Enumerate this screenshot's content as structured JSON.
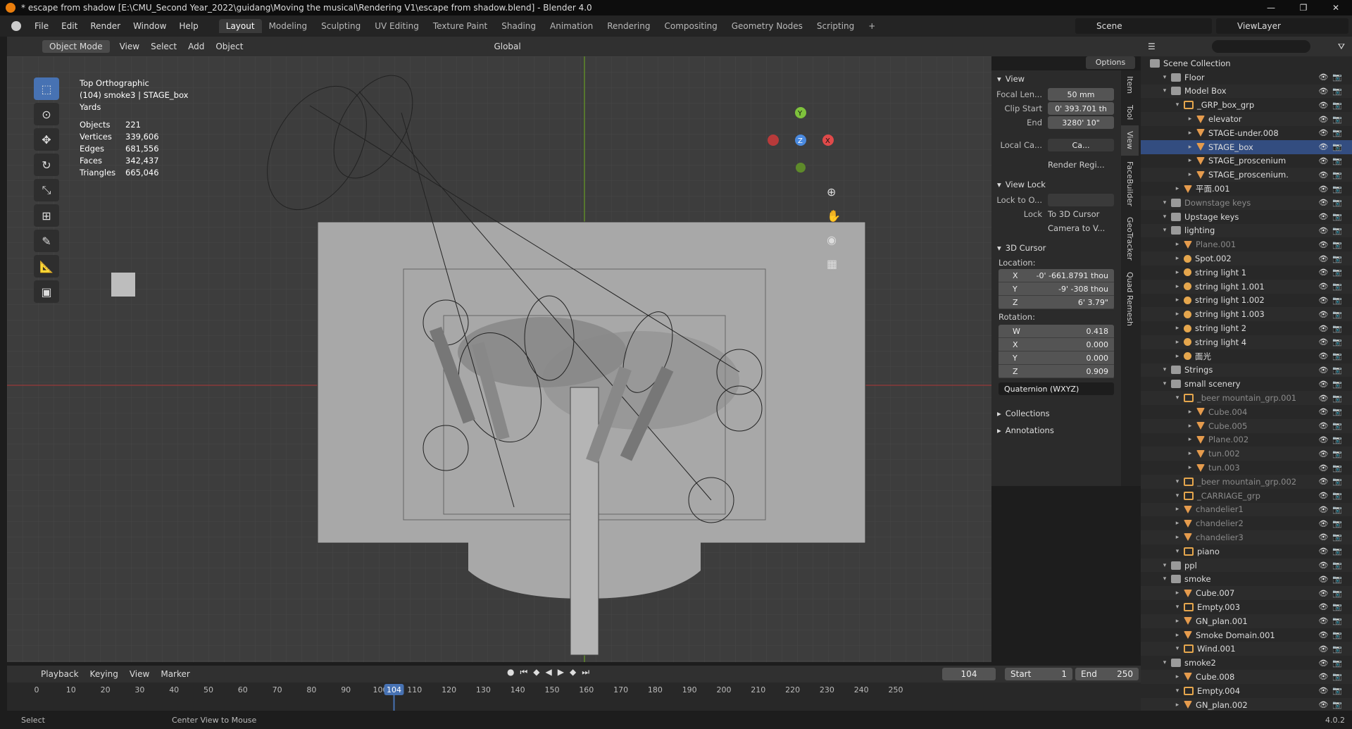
{
  "window": {
    "title": "* escape from shadow [E:\\CMU_Second Year_2022\\guidang\\Moving the musical\\Rendering V1\\escape from shadow.blend] - Blender 4.0",
    "controls": [
      "—",
      "❐",
      "✕"
    ]
  },
  "menu": [
    "File",
    "Edit",
    "Render",
    "Window",
    "Help"
  ],
  "workspaces": [
    {
      "label": "Layout",
      "active": true
    },
    {
      "label": "Modeling"
    },
    {
      "label": "Sculpting"
    },
    {
      "label": "UV Editing"
    },
    {
      "label": "Texture Paint"
    },
    {
      "label": "Shading"
    },
    {
      "label": "Animation"
    },
    {
      "label": "Rendering"
    },
    {
      "label": "Compositing"
    },
    {
      "label": "Geometry Nodes"
    },
    {
      "label": "Scripting"
    }
  ],
  "scene": "Scene",
  "view_layer": "ViewLayer",
  "viewport_header": {
    "mode": "Object Mode",
    "menus": [
      "View",
      "Select",
      "Add",
      "Object"
    ],
    "transform": "Global",
    "options": "Options"
  },
  "viewport_info": {
    "view": "Top Orthographic",
    "object": "(104) smoke3 | STAGE_box",
    "units": "Yards",
    "stats": [
      {
        "k": "Objects",
        "v": "221"
      },
      {
        "k": "Vertices",
        "v": "339,606"
      },
      {
        "k": "Edges",
        "v": "681,556"
      },
      {
        "k": "Faces",
        "v": "342,437"
      },
      {
        "k": "Triangles",
        "v": "665,046"
      }
    ]
  },
  "gizmo": {
    "x": "X",
    "y": "Y",
    "z": "Z"
  },
  "npanel": {
    "view_title": "View",
    "focal_label": "Focal Len...",
    "focal": "50 mm",
    "clip_start_label": "Clip Start",
    "clip_start": "0' 393.701 th",
    "end_label": "End",
    "clip_end": "3280' 10\"",
    "local_cam_label": "Local Ca...",
    "local_cam": "Ca...",
    "render_region": "Render Regi...",
    "view_lock_title": "View Lock",
    "lock_to_label": "Lock to O...",
    "lock_label": "Lock",
    "to_cursor": "To 3D Cursor",
    "camera_to_view": "Camera to V...",
    "cursor_title": "3D Cursor",
    "location_label": "Location:",
    "location": [
      {
        "k": "X",
        "v": "-0' -661.8791 thou"
      },
      {
        "k": "Y",
        "v": "-9' -308 thou"
      },
      {
        "k": "Z",
        "v": "6' 3.79\""
      }
    ],
    "rotation_label": "Rotation:",
    "rotation": [
      {
        "k": "W",
        "v": "0.418"
      },
      {
        "k": "X",
        "v": "0.000"
      },
      {
        "k": "Y",
        "v": "0.000"
      },
      {
        "k": "Z",
        "v": "0.909"
      }
    ],
    "rot_mode": "Quaternion (WXYZ)",
    "collections": "Collections",
    "annotations": "Annotations"
  },
  "ntabs": [
    "Item",
    "Tool",
    "View",
    "FaceBuilder",
    "GeoTracker",
    "Quad Remesh"
  ],
  "outliner": {
    "root": "Scene Collection",
    "rows": [
      {
        "n": "Floor",
        "d": 1,
        "t": "coll"
      },
      {
        "n": "Model Box",
        "d": 1,
        "t": "coll"
      },
      {
        "n": "_GRP_box_grp",
        "d": 2,
        "t": "empty"
      },
      {
        "n": "elevator",
        "d": 3,
        "t": "mesh"
      },
      {
        "n": "STAGE-under.008",
        "d": 3,
        "t": "mesh"
      },
      {
        "n": "STAGE_box",
        "d": 3,
        "t": "mesh",
        "sel": true
      },
      {
        "n": "STAGE_proscenium",
        "d": 3,
        "t": "mesh"
      },
      {
        "n": "STAGE_proscenium.",
        "d": 3,
        "t": "mesh"
      },
      {
        "n": "平面.001",
        "d": 2,
        "t": "mesh"
      },
      {
        "n": "Downstage keys",
        "d": 1,
        "t": "coll",
        "dim": true
      },
      {
        "n": "Upstage keys",
        "d": 1,
        "t": "coll"
      },
      {
        "n": "lighting",
        "d": 1,
        "t": "coll"
      },
      {
        "n": "Plane.001",
        "d": 2,
        "t": "mesh",
        "dim": true
      },
      {
        "n": "Spot.002",
        "d": 2,
        "t": "light"
      },
      {
        "n": "string light 1",
        "d": 2,
        "t": "light"
      },
      {
        "n": "string light 1.001",
        "d": 2,
        "t": "light"
      },
      {
        "n": "string light 1.002",
        "d": 2,
        "t": "light"
      },
      {
        "n": "string light 1.003",
        "d": 2,
        "t": "light"
      },
      {
        "n": "string light 2",
        "d": 2,
        "t": "light"
      },
      {
        "n": "string light 4",
        "d": 2,
        "t": "light"
      },
      {
        "n": "面光",
        "d": 2,
        "t": "light"
      },
      {
        "n": "Strings",
        "d": 1,
        "t": "coll"
      },
      {
        "n": "small scenery",
        "d": 1,
        "t": "coll"
      },
      {
        "n": "_beer mountain_grp.001",
        "d": 2,
        "t": "empty",
        "dim": true
      },
      {
        "n": "Cube.004",
        "d": 3,
        "t": "mesh",
        "dim": true
      },
      {
        "n": "Cube.005",
        "d": 3,
        "t": "mesh",
        "dim": true
      },
      {
        "n": "Plane.002",
        "d": 3,
        "t": "mesh",
        "dim": true
      },
      {
        "n": "tun.002",
        "d": 3,
        "t": "mesh",
        "dim": true
      },
      {
        "n": "tun.003",
        "d": 3,
        "t": "mesh",
        "dim": true
      },
      {
        "n": "_beer mountain_grp.002",
        "d": 2,
        "t": "empty",
        "dim": true
      },
      {
        "n": "_CARRIAGE_grp",
        "d": 2,
        "t": "empty",
        "dim": true
      },
      {
        "n": "chandelier1",
        "d": 2,
        "t": "mesh",
        "dim": true
      },
      {
        "n": "chandelier2",
        "d": 2,
        "t": "mesh",
        "dim": true
      },
      {
        "n": "chandelier3",
        "d": 2,
        "t": "mesh",
        "dim": true
      },
      {
        "n": "piano",
        "d": 2,
        "t": "empty"
      },
      {
        "n": "ppl",
        "d": 1,
        "t": "coll"
      },
      {
        "n": "smoke",
        "d": 1,
        "t": "coll"
      },
      {
        "n": "Cube.007",
        "d": 2,
        "t": "mesh"
      },
      {
        "n": "Empty.003",
        "d": 2,
        "t": "empty"
      },
      {
        "n": "GN_plan.001",
        "d": 2,
        "t": "mesh"
      },
      {
        "n": "Smoke Domain.001",
        "d": 2,
        "t": "mesh"
      },
      {
        "n": "Wind.001",
        "d": 2,
        "t": "empty"
      },
      {
        "n": "smoke2",
        "d": 1,
        "t": "coll"
      },
      {
        "n": "Cube.008",
        "d": 2,
        "t": "mesh"
      },
      {
        "n": "Empty.004",
        "d": 2,
        "t": "empty"
      },
      {
        "n": "GN_plan.002",
        "d": 2,
        "t": "mesh"
      }
    ]
  },
  "timeline": {
    "menus": [
      "Playback",
      "Keying",
      "View",
      "Marker"
    ],
    "current_frame": "104",
    "start_label": "Start",
    "start": "1",
    "end_label": "End",
    "end": "250",
    "ticks": [
      "0",
      "10",
      "20",
      "30",
      "40",
      "50",
      "60",
      "70",
      "80",
      "90",
      "100",
      "110",
      "120",
      "130",
      "140",
      "150",
      "160",
      "170",
      "180",
      "190",
      "200",
      "210",
      "220",
      "230",
      "240",
      "250"
    ]
  },
  "status": {
    "left": "Select",
    "mid": "Center View to Mouse",
    "version": "4.0.2"
  }
}
